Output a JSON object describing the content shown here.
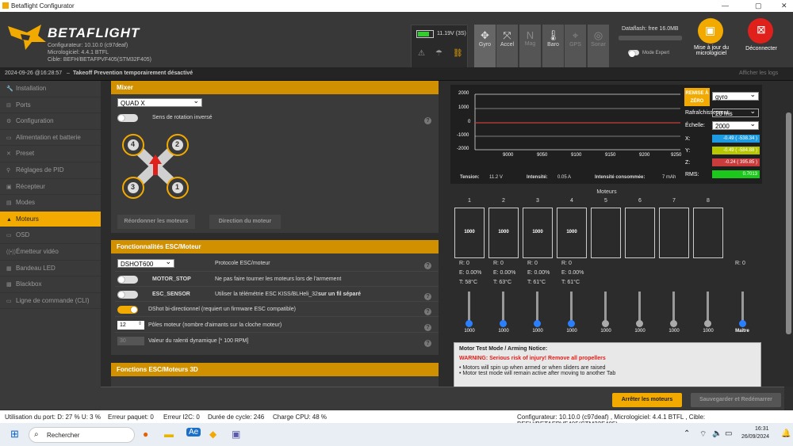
{
  "window": {
    "title": "Betaflight Configurator"
  },
  "header": {
    "logo": "BETAFLIGHT",
    "configurator_line": "Configurateur: 10.10.0 (c97deaf)",
    "firmware_line": "Micrologiciel: 4.4.1 BTFL",
    "target_line": "Cible: BEFH/BETAFPVF405(STM32F405)",
    "battery": "11.19V (3S)",
    "sensors": [
      {
        "label": "Gyro",
        "icon": "gyro-icon",
        "glyph": "✥"
      },
      {
        "label": "Accel",
        "icon": "accel-icon",
        "glyph": "⤧"
      },
      {
        "label": "Mag",
        "icon": "mag-icon",
        "glyph": "N"
      },
      {
        "label": "Baro",
        "icon": "baro-icon",
        "glyph": "🌡"
      },
      {
        "label": "GPS",
        "icon": "gps-icon",
        "glyph": "⌖"
      },
      {
        "label": "Sonar",
        "icon": "sonar-icon",
        "glyph": "◎"
      }
    ],
    "dataflash": "Dataflash: free 16.0MB",
    "expert_mode": "Mode Expert",
    "update_firmware": "Mise à jour du micrologiciel",
    "disconnect": "Déconnecter"
  },
  "status_line": {
    "timestamp": "2024-09-26 @16:28:57",
    "message": "Takeoff Prevention temporairement désactivé",
    "show_logs": "Afficher les logs"
  },
  "sidebar": {
    "items": [
      {
        "label": "Installation",
        "icon": "wrench-icon",
        "glyph": "🔧",
        "active": false
      },
      {
        "label": "Ports",
        "icon": "plug-icon",
        "glyph": "⊟",
        "active": false
      },
      {
        "label": "Configuration",
        "icon": "gear-icon",
        "glyph": "⚙",
        "active": false
      },
      {
        "label": "Alimentation et batterie",
        "icon": "battery-icon",
        "glyph": "▭",
        "active": false
      },
      {
        "label": "Preset",
        "icon": "preset-icon",
        "glyph": "✕",
        "active": false
      },
      {
        "label": "Réglages de PID",
        "icon": "pid-icon",
        "glyph": "⚲",
        "active": false
      },
      {
        "label": "Récepteur",
        "icon": "receiver-icon",
        "glyph": "▣",
        "active": false
      },
      {
        "label": "Modes",
        "icon": "modes-icon",
        "glyph": "▤",
        "active": false
      },
      {
        "label": "Moteurs",
        "icon": "motor-icon",
        "glyph": "▲",
        "active": true
      },
      {
        "label": "OSD",
        "icon": "osd-icon",
        "glyph": "▭",
        "active": false
      },
      {
        "label": "Émetteur vidéo",
        "icon": "vtx-icon",
        "glyph": "((•))",
        "active": false
      },
      {
        "label": "Bandeau LED",
        "icon": "led-icon",
        "glyph": "▦",
        "active": false
      },
      {
        "label": "Blackbox",
        "icon": "blackbox-icon",
        "glyph": "▩",
        "active": false
      },
      {
        "label": "Ligne de commande (CLI)",
        "icon": "cli-icon",
        "glyph": "▭",
        "active": false
      }
    ]
  },
  "mixer": {
    "title": "Mixer",
    "frame": "QUAD X",
    "reverse_label": "Sens de rotation inversé",
    "motor_numbers": [
      "4",
      "2",
      "3",
      "1"
    ],
    "reorder_button": "Réordonner les moteurs",
    "direction_button": "Direction du moteur"
  },
  "esc": {
    "title": "Fonctionnalités ESC/Moteur",
    "protocol_value": "DSHOT600",
    "protocol_label": "Protocole ESC/moteur",
    "motor_stop": "MOTOR_STOP",
    "motor_stop_desc": "Ne pas faire tourner les moteurs lors de l'armement",
    "esc_sensor": "ESC_SENSOR",
    "esc_sensor_desc": "Utiliser la télémétrie ESC KISS/BLHeli_32",
    "esc_sensor_desc_bold": "sur un fil séparé",
    "bidir": "DShot bi-directionnel (requiert un firmware ESC compatible)",
    "poles_value": "12",
    "poles_label": "Pôles moteur (nombre d'aimants sur la cloche moteur)",
    "idle_value": "30",
    "idle_label": "Valeur du ralenti dynamique [* 100 RPM]"
  },
  "esc3d": {
    "title": "Fonctions ESC/Moteurs 3D"
  },
  "graph": {
    "reset_button": "REMISE À ZÉRO",
    "sensor_select": "gyro",
    "refresh_label": "Rafraîchissement:",
    "refresh_value": "20 ms",
    "scale_label": "Échelle:",
    "scale_value": "2000",
    "x_label": "X:",
    "x_value": "-0.49 ( -538.34 )",
    "y_label": "Y:",
    "y_value": "-0.49 ( -584.88 )",
    "z_label": "Z:",
    "z_value": "-0.24 ( 395.85 )",
    "rms_label": "RMS:",
    "rms_value": "0.7013",
    "y_ticks": [
      "2000",
      "1000",
      "0",
      "-1000",
      "-2000"
    ],
    "x_ticks": [
      "9000",
      "9050",
      "9100",
      "9150",
      "9200",
      "9250"
    ],
    "tension_label": "Tension:",
    "tension_value": "11.2 V",
    "intensity_label": "Intensité:",
    "intensity_value": "0.05 A",
    "consumed_label": "Intensité consommée:",
    "consumed_value": "7 mAh",
    "colors": {
      "x": "#1e9be0",
      "y": "#b8c800",
      "z": "#c83c3c",
      "rms": "#1bc81b"
    }
  },
  "motors": {
    "title": "Moteurs",
    "numbers": [
      "1",
      "2",
      "3",
      "4",
      "5",
      "6",
      "7",
      "8"
    ],
    "box_values": [
      "1000",
      "1000",
      "1000",
      "1000",
      "",
      "",
      "",
      ""
    ],
    "telemetry": [
      {
        "r": "R: 0",
        "e": "E: 0.00%",
        "t": "T: 58°C"
      },
      {
        "r": "R: 0",
        "e": "E: 0.00%",
        "t": "T: 63°C"
      },
      {
        "r": "R: 0",
        "e": "E: 0.00%",
        "t": "T: 61°C"
      },
      {
        "r": "R: 0",
        "e": "E: 0.00%",
        "t": "T: 61°C"
      }
    ],
    "master_r": "R: 0",
    "slider_values": [
      "1000",
      "1000",
      "1000",
      "1000",
      "1000",
      "1000",
      "1000",
      "1000"
    ],
    "master_label": "Maître",
    "notice_title": "Motor Test Mode / Arming Notice:",
    "notice_warning": "WARNING: Serious risk of injury! Remove all propellers",
    "notice_line1": "• Motors will spin up when armed or when sliders are raised",
    "notice_line2": "• Motor test mode will remain active after moving to another Tab"
  },
  "bottom": {
    "stop_motors": "Arrêter les moteurs",
    "save_reboot": "Sauvegarder et Redémarrer"
  },
  "footer": {
    "port_usage": "Utilisation du port: D: 27 % U: 3 %",
    "packet_error": "Erreur paquet: 0",
    "i2c_error": "Erreur I2C: 0",
    "cycle": "Durée de cycle: 246",
    "cpu": "Charge CPU: 48 %",
    "version": "Configurateur: 10.10.0 (c97deaf) , Micrologiciel: 4.4.1 BTFL , Cible: BEFH/BETAFPVF405(STM32F405)"
  },
  "taskbar": {
    "search": "Rechercher",
    "time": "16:31",
    "date": "26/09/2024"
  }
}
